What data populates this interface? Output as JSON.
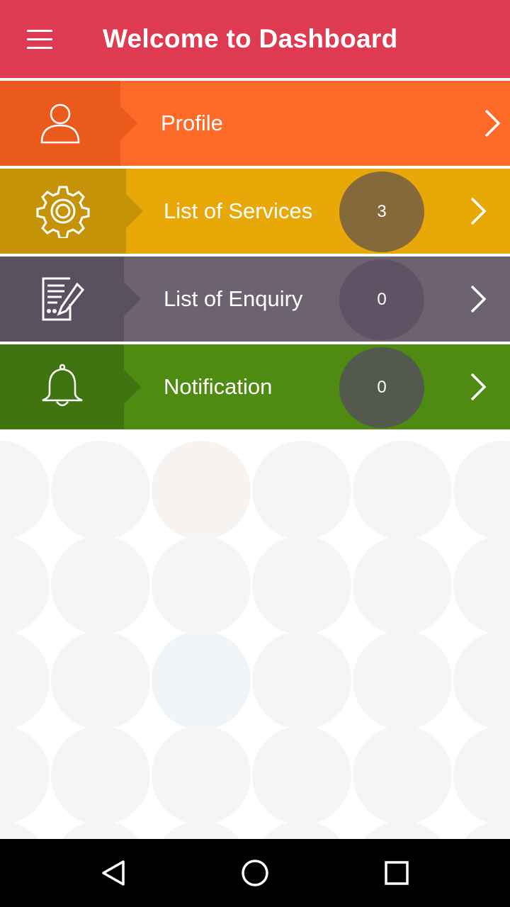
{
  "appbar": {
    "title": "Welcome to Dashboard",
    "menu_icon": "hamburger-menu-icon",
    "background": "#de3a52"
  },
  "menu": [
    {
      "label": "Profile",
      "icon": "user-icon",
      "badge": null,
      "color": "#fe6a28",
      "icon_bg": "#ea5a1c"
    },
    {
      "label": "List of Services",
      "icon": "gear-icon",
      "badge": "3",
      "color": "#e8a807",
      "icon_bg": "#c49308"
    },
    {
      "label": "List of Enquiry",
      "icon": "document-edit-icon",
      "badge": "0",
      "color": "#6c6270",
      "icon_bg": "#5a5160"
    },
    {
      "label": "Notification",
      "icon": "bell-icon",
      "badge": "0",
      "color": "#4f8a12",
      "icon_bg": "#3f7410"
    }
  ],
  "navbar": {
    "back_icon": "back-triangle-icon",
    "home_icon": "home-circle-icon",
    "recents_icon": "recents-square-icon"
  }
}
